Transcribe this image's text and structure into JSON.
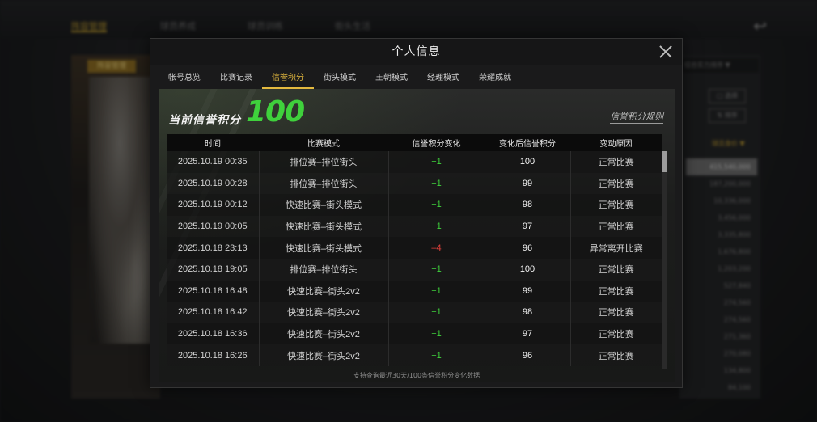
{
  "background": {
    "tabs": [
      "阵容管理",
      "球员养成",
      "球员训练",
      "街头生活"
    ],
    "left_tag": "阵容管理",
    "right_select": "综合实力排序 ▼",
    "right_buttons": [
      "□ 选择",
      "⇅ 排序"
    ],
    "right_header": "球员身价 ▼",
    "right_values": [
      "415,540,000",
      "187,200,000",
      "10,336,000",
      "3,456,000",
      "3,335,800",
      "1,676,800",
      "1,203,200",
      "527,840",
      "274,560",
      "274,560",
      "271,360",
      "270,080",
      "134,800",
      "84,100"
    ]
  },
  "modal": {
    "title": "个人信息",
    "tabs": [
      {
        "label": "帐号总览",
        "active": false
      },
      {
        "label": "比赛记录",
        "active": false
      },
      {
        "label": "信誉积分",
        "active": true
      },
      {
        "label": "街头模式",
        "active": false
      },
      {
        "label": "王朝模式",
        "active": false
      },
      {
        "label": "经理模式",
        "active": false
      },
      {
        "label": "荣耀成就",
        "active": false
      }
    ],
    "score_label": "当前信誉积分",
    "score_value": "100",
    "rules_link": "信誉积分规则",
    "table": {
      "headers": [
        "时间",
        "比赛模式",
        "信誉积分变化",
        "变化后信誉积分",
        "变动原因"
      ],
      "rows": [
        [
          "2025.10.19  00:35",
          "排位赛–排位街头",
          "+1",
          "100",
          "正常比赛"
        ],
        [
          "2025.10.19  00:28",
          "排位赛–排位街头",
          "+1",
          "99",
          "正常比赛"
        ],
        [
          "2025.10.19  00:12",
          "快速比赛–街头模式",
          "+1",
          "98",
          "正常比赛"
        ],
        [
          "2025.10.19  00:05",
          "快速比赛–街头模式",
          "+1",
          "97",
          "正常比赛"
        ],
        [
          "2025.10.18  23:13",
          "快速比赛–街头模式",
          "–4",
          "96",
          "异常离开比赛"
        ],
        [
          "2025.10.18  19:05",
          "排位赛–排位街头",
          "+1",
          "100",
          "正常比赛"
        ],
        [
          "2025.10.18  16:48",
          "快速比赛–街头2v2",
          "+1",
          "99",
          "正常比赛"
        ],
        [
          "2025.10.18  16:42",
          "快速比赛–街头2v2",
          "+1",
          "98",
          "正常比赛"
        ],
        [
          "2025.10.18  16:36",
          "快速比赛–街头2v2",
          "+1",
          "97",
          "正常比赛"
        ],
        [
          "2025.10.18  16:26",
          "快速比赛–街头2v2",
          "+1",
          "96",
          "正常比赛"
        ]
      ]
    },
    "footer_note": "支持查询最近30天/100条信誉积分变化数据",
    "colors": {
      "accent": "#e4b93f",
      "positive": "#3fd13c",
      "negative": "#e2403a"
    }
  }
}
